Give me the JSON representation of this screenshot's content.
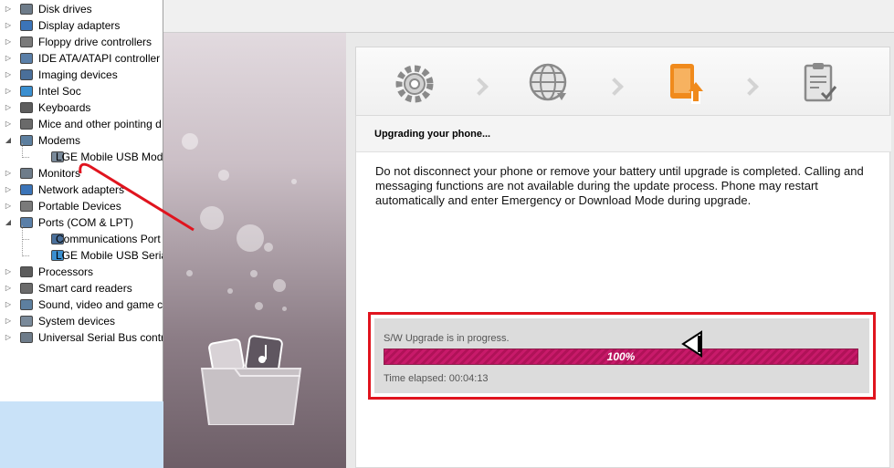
{
  "device_manager": {
    "items": [
      {
        "label": "Disk drives",
        "expanded": false,
        "level": 0
      },
      {
        "label": "Display adapters",
        "expanded": false,
        "level": 0
      },
      {
        "label": "Floppy drive controllers",
        "expanded": false,
        "level": 0
      },
      {
        "label": "IDE ATA/ATAPI controller",
        "expanded": false,
        "level": 0
      },
      {
        "label": "Imaging devices",
        "expanded": false,
        "level": 0
      },
      {
        "label": "Intel Soc",
        "expanded": false,
        "level": 0
      },
      {
        "label": "Keyboards",
        "expanded": false,
        "level": 0
      },
      {
        "label": "Mice and other pointing d",
        "expanded": false,
        "level": 0
      },
      {
        "label": "Modems",
        "expanded": true,
        "level": 0
      },
      {
        "label": "LGE Mobile USB Mode",
        "expanded": null,
        "level": 1
      },
      {
        "label": "Monitors",
        "expanded": false,
        "level": 0
      },
      {
        "label": "Network adapters",
        "expanded": false,
        "level": 0
      },
      {
        "label": "Portable Devices",
        "expanded": false,
        "level": 0
      },
      {
        "label": "Ports (COM & LPT)",
        "expanded": true,
        "level": 0
      },
      {
        "label": "Communications Port",
        "expanded": null,
        "level": 1
      },
      {
        "label": "LGE Mobile USB Serial",
        "expanded": null,
        "level": 1
      },
      {
        "label": "Processors",
        "expanded": false,
        "level": 0
      },
      {
        "label": "Smart card readers",
        "expanded": false,
        "level": 0
      },
      {
        "label": "Sound, video and game c",
        "expanded": false,
        "level": 0
      },
      {
        "label": "System devices",
        "expanded": false,
        "level": 0
      },
      {
        "label": "Universal Serial Bus contro",
        "expanded": false,
        "level": 0
      }
    ]
  },
  "upgrade_tool": {
    "steps": [
      {
        "icon": "gear-icon",
        "active": false
      },
      {
        "icon": "globe-download-icon",
        "active": false
      },
      {
        "icon": "phone-upload-icon",
        "active": true
      },
      {
        "icon": "clipboard-check-icon",
        "active": false
      }
    ],
    "section_title": "Upgrading your phone...",
    "message": "Do not disconnect your phone or remove your battery until upgrade is completed.  Calling and messaging functions are not available during the update process. Phone may restart automatically and enter Emergency or Download Mode during upgrade.",
    "progress": {
      "status": "S/W Upgrade is in progress.",
      "percent_label": "100%",
      "fraction": 1.0,
      "elapsed": "Time elapsed: 00:04:13"
    }
  },
  "colors": {
    "accent": "#e0141e",
    "progress": "#c81a6a",
    "active_step": "#f08a1c"
  }
}
